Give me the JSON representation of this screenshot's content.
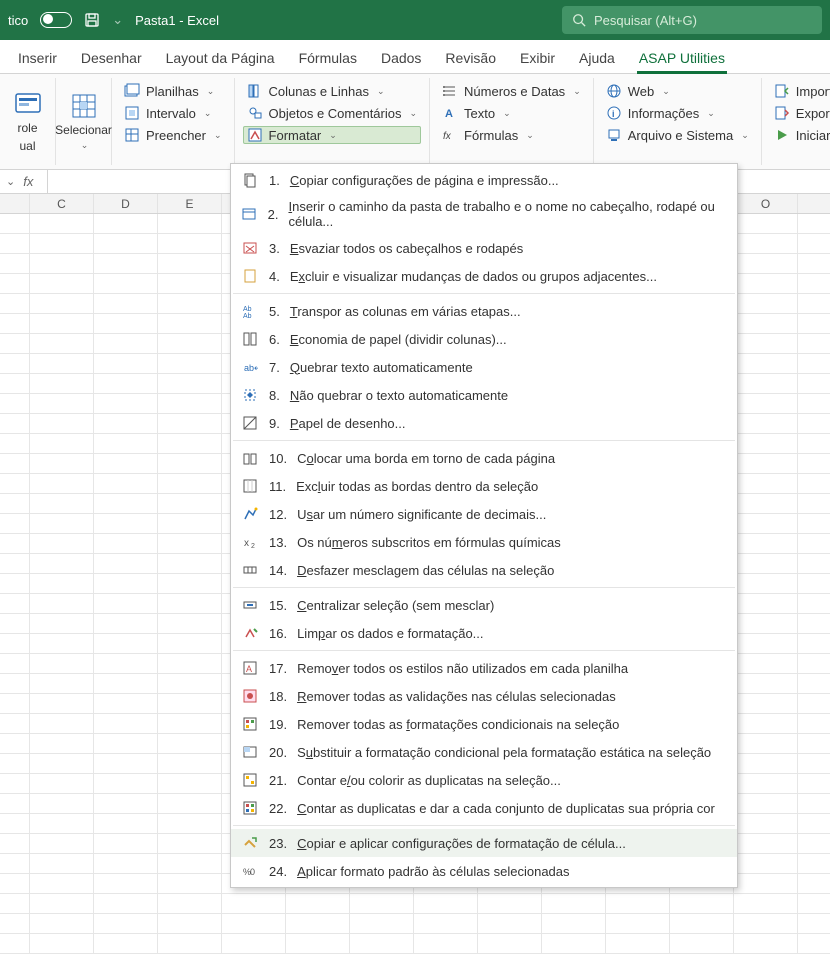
{
  "titlebar": {
    "left_label": "tico",
    "doc_title": "Pasta1 - Excel",
    "search_placeholder": "Pesquisar (Alt+G)"
  },
  "tabs": {
    "items": [
      {
        "label": "Inserir"
      },
      {
        "label": "Desenhar"
      },
      {
        "label": "Layout da Página"
      },
      {
        "label": "Fórmulas"
      },
      {
        "label": "Dados"
      },
      {
        "label": "Revisão"
      },
      {
        "label": "Exibir"
      },
      {
        "label": "Ajuda"
      },
      {
        "label": "ASAP Utilities"
      }
    ],
    "active_index": 8
  },
  "ribbon": {
    "controle": {
      "label1": "role",
      "label2": "ual"
    },
    "selecionar": {
      "label": "Selecionar"
    },
    "group2": {
      "planilhas": "Planilhas",
      "intervalo": "Intervalo",
      "preencher": "Preencher"
    },
    "group3": {
      "colunas": "Colunas e Linhas",
      "objetos": "Objetos e Comentários",
      "formatar": "Formatar"
    },
    "group4": {
      "numeros": "Números e Datas",
      "texto": "Texto",
      "formulas": "Fórmulas"
    },
    "group5": {
      "web": "Web",
      "info": "Informações",
      "arquivo": "Arquivo e Sistema"
    },
    "group6": {
      "importar": "Importar",
      "exportar": "Exportar",
      "iniciar": "Iniciar"
    }
  },
  "fx": {
    "label": "fx"
  },
  "columns": [
    "",
    "C",
    "D",
    "E",
    "",
    "",
    "",
    "",
    "",
    "",
    "",
    "",
    "O"
  ],
  "dropdown": {
    "items": [
      {
        "text": "Copiar configurações de página e impressão...",
        "ukey": "C"
      },
      {
        "text": "Inserir o caminho da pasta de trabalho e o nome no cabeçalho, rodapé ou célula...",
        "ukey": "I"
      },
      {
        "text": "Esvaziar todos os cabeçalhos e rodapés",
        "ukey": "E"
      },
      {
        "text": "Excluir e visualizar mudanças de dados ou grupos adjacentes...",
        "ukey": "x"
      },
      {
        "text": "Transpor as colunas em várias etapas...",
        "ukey": "T"
      },
      {
        "text": "Economia de papel (dividir colunas)...",
        "ukey": "E"
      },
      {
        "text": "Quebrar texto automaticamente",
        "ukey": "Q"
      },
      {
        "text": "Não quebrar o texto automaticamente",
        "ukey": "N"
      },
      {
        "text": "Papel de desenho...",
        "ukey": "P"
      },
      {
        "text": "Colocar uma borda em torno de cada página",
        "ukey": "o"
      },
      {
        "text": "Excluir todas as bordas dentro da seleção",
        "ukey": "l"
      },
      {
        "text": "Usar um número significante de decimais...",
        "ukey": "s"
      },
      {
        "text": "Os números subscritos em fórmulas químicas",
        "ukey": "m"
      },
      {
        "text": "Desfazer mesclagem das células na seleção",
        "ukey": "D"
      },
      {
        "text": "Centralizar seleção (sem mesclar)",
        "ukey": "C"
      },
      {
        "text": "Limpar os dados e formatação...",
        "ukey": "p"
      },
      {
        "text": "Remover todos os estilos não utilizados em cada planilha",
        "ukey": "v"
      },
      {
        "text": "Remover todas as validações nas células selecionadas",
        "ukey": "R"
      },
      {
        "text": "Remover todas as formatações condicionais na seleção",
        "ukey": "f"
      },
      {
        "text": "Substituir a formatação condicional pela formatação estática na seleção",
        "ukey": "u"
      },
      {
        "text": "Contar e/ou colorir as duplicatas na seleção...",
        "ukey": "/"
      },
      {
        "text": "Contar as duplicatas e dar a cada conjunto de duplicatas sua própria cor",
        "ukey": "C"
      },
      {
        "text": "Copiar e aplicar configurações de formatação de célula...",
        "ukey": "C",
        "hover": true
      },
      {
        "text": "Aplicar formato padrão às células selecionadas",
        "ukey": "A"
      }
    ]
  }
}
